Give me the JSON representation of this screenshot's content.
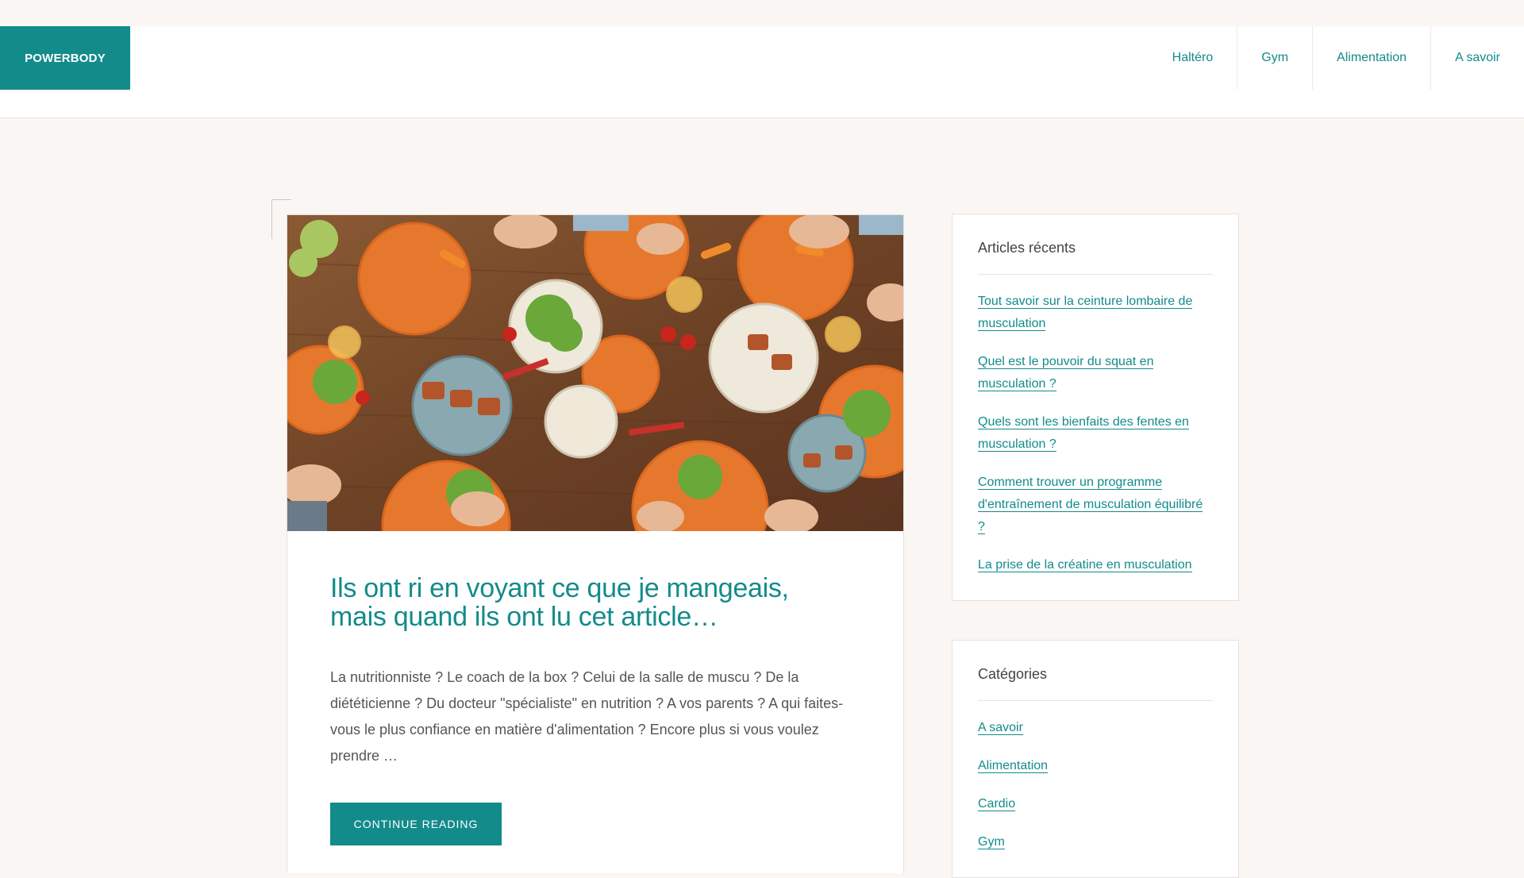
{
  "site": {
    "logo": "POWERBODY"
  },
  "nav": [
    {
      "label": "Haltéro"
    },
    {
      "label": "Gym"
    },
    {
      "label": "Alimentation"
    },
    {
      "label": "A savoir"
    }
  ],
  "article": {
    "image_alt": "Table de repas vue de dessus avec des assiettes orange, salades et brochettes",
    "title": "Ils ont ri en voyant ce que je mangeais, mais quand ils ont lu cet article…",
    "excerpt": "La nutritionniste ? Le coach de la box ? Celui de la salle de muscu ? De la diététicienne ? Du docteur \"spécialiste\" en nutrition ? A vos parents ? A qui faites-vous le plus confiance en matière d'alimentation ? Encore plus si vous voulez prendre …",
    "continue_label": "CONTINUE READING"
  },
  "sidebar": {
    "recent": {
      "title": "Articles récents",
      "items": [
        {
          "label": "Tout savoir sur la ceinture lombaire de musculation"
        },
        {
          "label": "Quel est le pouvoir du squat en musculation ?"
        },
        {
          "label": "Quels sont les bienfaits des fentes en musculation ?"
        },
        {
          "label": "Comment trouver un programme d'entraînement de musculation équilibré ?"
        },
        {
          "label": "La prise de la créatine en musculation"
        }
      ]
    },
    "categories": {
      "title": "Catégories",
      "items": [
        {
          "label": "A savoir"
        },
        {
          "label": "Alimentation"
        },
        {
          "label": "Cardio"
        },
        {
          "label": "Gym"
        }
      ]
    }
  },
  "colors": {
    "accent": "#138b8b",
    "background": "#f9f6f4"
  }
}
